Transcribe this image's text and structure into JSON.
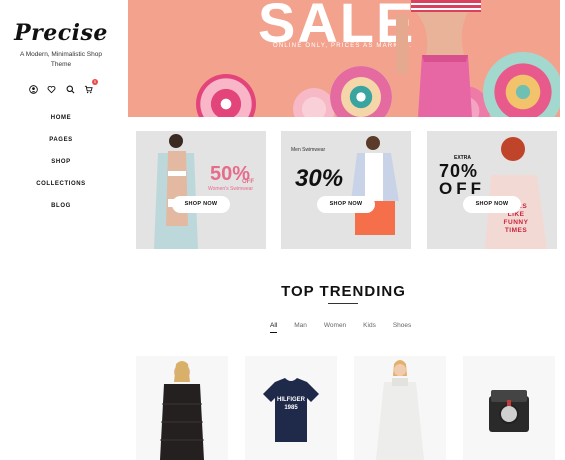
{
  "brand": {
    "logo": "Precise",
    "tagline": "A Modern, Minimalistic Shop Theme"
  },
  "header_icons": [
    "user-icon",
    "heart-icon",
    "search-icon",
    "cart-icon"
  ],
  "cart_count": "0",
  "nav": [
    "HOME",
    "PAGES",
    "SHOP",
    "COLLECTIONS",
    "BLOG"
  ],
  "hero": {
    "title": "SALE",
    "subtitle": "ONLINE ONLY, PRICES AS MARKED."
  },
  "promos": [
    {
      "label_top": "",
      "big": "50%",
      "off": "OFF",
      "sub": "Women's Swimwear",
      "button": "SHOP NOW"
    },
    {
      "label_top": "Men Swimwear",
      "big": "30%",
      "off": "",
      "sub": "",
      "button": "SHOP NOW"
    },
    {
      "label_top": "EXTRA",
      "big": "70%",
      "off": "OFF",
      "sub": "",
      "button": "SHOP NOW"
    }
  ],
  "shirt_text": "GIRLS LIKE FUNNY TIMES",
  "tshirt_text": "HILFIGER 1985",
  "trending": {
    "title": "TOP TRENDING",
    "tabs": [
      "All",
      "Man",
      "Women",
      "Kids",
      "Shoes"
    ],
    "active_tab": "All"
  },
  "colors": {
    "accent": "#e84b4b",
    "hero_bg": "#f3a28d",
    "promo_pink": "#e66c8c"
  }
}
